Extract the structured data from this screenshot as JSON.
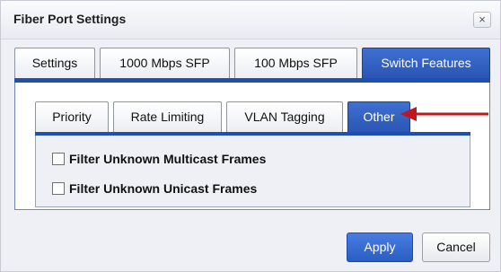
{
  "dialog": {
    "title": "Fiber Port Settings",
    "close_label": "×"
  },
  "outer_tabs": [
    {
      "label": "Settings",
      "active": false
    },
    {
      "label": "1000 Mbps SFP",
      "active": false
    },
    {
      "label": "100 Mbps SFP",
      "active": false
    },
    {
      "label": "Switch Features",
      "active": true
    }
  ],
  "inner_tabs": [
    {
      "label": "Priority",
      "active": false
    },
    {
      "label": "Rate Limiting",
      "active": false
    },
    {
      "label": "VLAN Tagging",
      "active": false
    },
    {
      "label": "Other",
      "active": true
    }
  ],
  "options": [
    {
      "label": "Filter Unknown Multicast Frames",
      "checked": false
    },
    {
      "label": "Filter Unknown Unicast Frames",
      "checked": false
    }
  ],
  "buttons": {
    "apply": "Apply",
    "cancel": "Cancel"
  },
  "colors": {
    "accent": "#2a56b5",
    "annotation_arrow": "#c0161e"
  }
}
